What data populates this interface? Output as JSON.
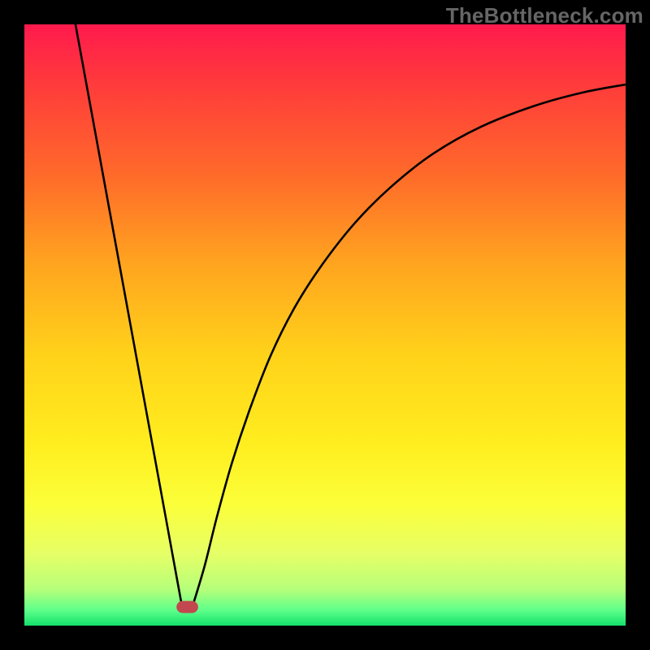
{
  "watermark": "TheBottleneck.com",
  "chart_data": {
    "type": "line",
    "title": "",
    "xlabel": "",
    "ylabel": "",
    "xlim": [
      0,
      100
    ],
    "ylim": [
      0,
      100
    ],
    "background_gradient": {
      "stops": [
        {
          "offset": 0.0,
          "color": "#ff1a4d"
        },
        {
          "offset": 0.1,
          "color": "#ff3b3b"
        },
        {
          "offset": 0.25,
          "color": "#ff6a2a"
        },
        {
          "offset": 0.4,
          "color": "#ffa51f"
        },
        {
          "offset": 0.55,
          "color": "#ffd21a"
        },
        {
          "offset": 0.7,
          "color": "#ffee1f"
        },
        {
          "offset": 0.8,
          "color": "#fbff3a"
        },
        {
          "offset": 0.88,
          "color": "#e6ff66"
        },
        {
          "offset": 0.94,
          "color": "#b6ff7a"
        },
        {
          "offset": 0.975,
          "color": "#5cff8a"
        },
        {
          "offset": 1.0,
          "color": "#14e06a"
        }
      ]
    },
    "series": [
      {
        "name": "left-branch",
        "stroke": "#000000",
        "points": [
          {
            "x": 8.5,
            "y": 100.0
          },
          {
            "x": 26.2,
            "y": 3.3
          }
        ]
      },
      {
        "name": "right-branch",
        "stroke": "#000000",
        "points": [
          {
            "x": 28.0,
            "y": 3.3
          },
          {
            "x": 30.0,
            "y": 10.0
          },
          {
            "x": 32.0,
            "y": 18.0
          },
          {
            "x": 34.5,
            "y": 27.0
          },
          {
            "x": 37.5,
            "y": 36.0
          },
          {
            "x": 41.0,
            "y": 45.0
          },
          {
            "x": 45.0,
            "y": 53.0
          },
          {
            "x": 49.5,
            "y": 60.0
          },
          {
            "x": 55.0,
            "y": 67.0
          },
          {
            "x": 61.0,
            "y": 73.0
          },
          {
            "x": 68.0,
            "y": 78.5
          },
          {
            "x": 76.0,
            "y": 83.0
          },
          {
            "x": 85.0,
            "y": 86.5
          },
          {
            "x": 93.0,
            "y": 88.7
          },
          {
            "x": 100.0,
            "y": 90.0
          }
        ]
      }
    ],
    "markers": [
      {
        "name": "minimum-marker",
        "shape": "rounded-pill",
        "cx": 27.1,
        "cy": 3.1,
        "w": 3.6,
        "h": 2.0,
        "fill": "#c2474f"
      }
    ]
  }
}
